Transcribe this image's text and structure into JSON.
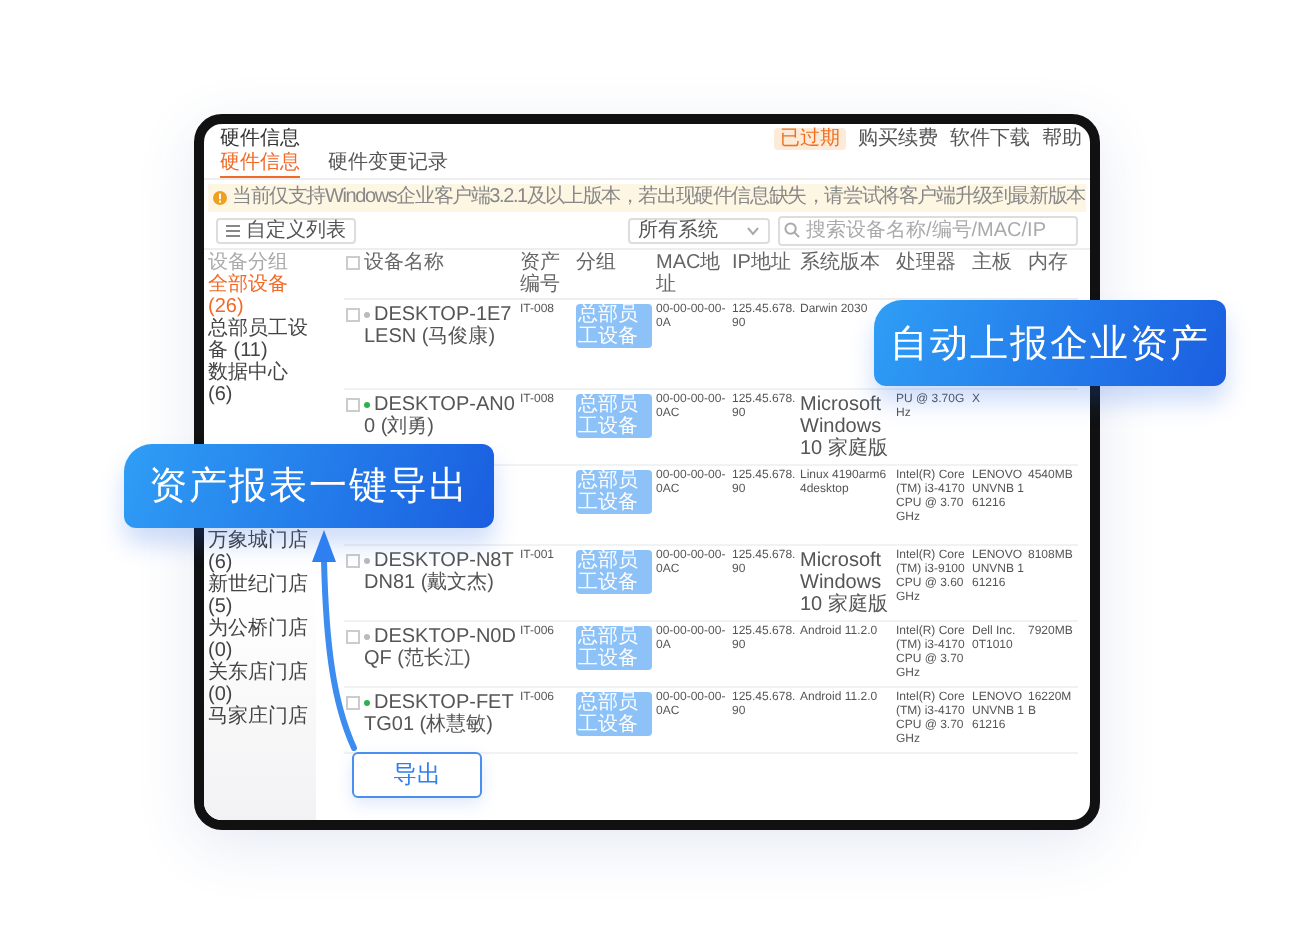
{
  "header": {
    "title": "硬件信息",
    "status": "已过期",
    "links": [
      "购买续费",
      "软件下载",
      "帮助"
    ]
  },
  "tabs": [
    {
      "label": "硬件信息",
      "selected": true
    },
    {
      "label": "硬件变更记录",
      "selected": false
    }
  ],
  "notice": "当前仅支持Windows企业客户端3.2.1及以上版本，若出现硬件信息缺失，请尝试将客户端升级到最新版本",
  "toolbar": {
    "button": "自定义列表",
    "system_filter": "所有系统",
    "search": {
      "placeholder": "搜索设备名称/编号/MAC/IP"
    }
  },
  "sidebar": {
    "heading": "设备分组",
    "items": [
      {
        "label": "全部设备(26)",
        "selected": true
      },
      {
        "label": "总部员工设备 (11)",
        "selected": false
      },
      {
        "label": "数据中心 (6)",
        "selected": false
      },
      {
        "label": "万象城门店 (6)",
        "selected": false
      },
      {
        "label": "新世纪门店 (5)",
        "selected": false
      },
      {
        "label": "为公桥门店 (0)",
        "selected": false
      },
      {
        "label": "关东店门店 (0)",
        "selected": false
      },
      {
        "label": "马家庄门店",
        "selected": false
      }
    ]
  },
  "table": {
    "select_all_checked": false,
    "columns": [
      "设备名称",
      "资产编号",
      "分组",
      "MAC地址",
      "IP地址",
      "系统版本",
      "处理器",
      "主板",
      "内存"
    ],
    "rows": [
      {
        "checked": false,
        "online": false,
        "name": "DESKTOP-1E7LESN (马俊康)",
        "asset": "IT-008",
        "group": "总部员工设备",
        "mac": "00-00-00-00-0A",
        "ip": "125.45.678.90",
        "os": "Darwin 2030"
      },
      {
        "checked": false,
        "online": true,
        "name": "DESKTOP-AN00 (刘勇)",
        "asset": "IT-008",
        "group": "总部员工设备",
        "mac": "00-00-00-00-0AC",
        "ip": "125.45.678.90",
        "os": "Microsoft Windows 10 家庭版",
        "cpu": "PU @ 3.70GHz",
        "board": "X"
      },
      {
        "group": "总部员工设备",
        "mac": "00-00-00-00-0AC",
        "ip": "125.45.678.90",
        "os": "Linux 4190arm64desktop",
        "cpu": "Intel(R) Core(TM) i3-4170 CPU @ 3.70GHz",
        "board": "LENOVO UNVNB 161216",
        "memory": "4540MB"
      },
      {
        "checked": false,
        "online": false,
        "name": "DESKTOP-N8TDN81 (戴文杰)",
        "asset": "IT-001",
        "group": "总部员工设备",
        "mac": "00-00-00-00-0AC",
        "ip": "125.45.678.90",
        "os": "Microsoft Windows 10 家庭版",
        "cpu": "Intel(R) Core(TM) i3-9100 CPU @ 3.60GHz",
        "board": "LENOVO UNVNB 161216",
        "memory": "8108MB"
      },
      {
        "checked": false,
        "online": false,
        "name": "DESKTOP-N0DQF (范长江)",
        "asset": "IT-006",
        "group": "总部员工设备",
        "mac": "00-00-00-00-0A",
        "ip": "125.45.678.90",
        "os": "Android 11.2.0",
        "cpu": "Intel(R) Core(TM) i3-4170 CPU @ 3.70GHz",
        "board": "Dell Inc. 0T1010",
        "memory": "7920MB"
      },
      {
        "checked": false,
        "online": true,
        "name": "DESKTOP-FETTG01 (林慧敏)",
        "asset": "IT-006",
        "group": "总部员工设备",
        "mac": "00-00-00-00-0AC",
        "ip": "125.45.678.90",
        "os": "Android 11.2.0",
        "cpu": "Intel(R) Core(TM) i3-4170 CPU @ 3.70GHz",
        "board": "LENOVO UNVNB 161216",
        "memory": "16220MB"
      }
    ]
  },
  "callouts": {
    "auto_report": "自动上报企业资产",
    "one_click_export": "资产报表一键导出"
  },
  "export_button": "导出"
}
